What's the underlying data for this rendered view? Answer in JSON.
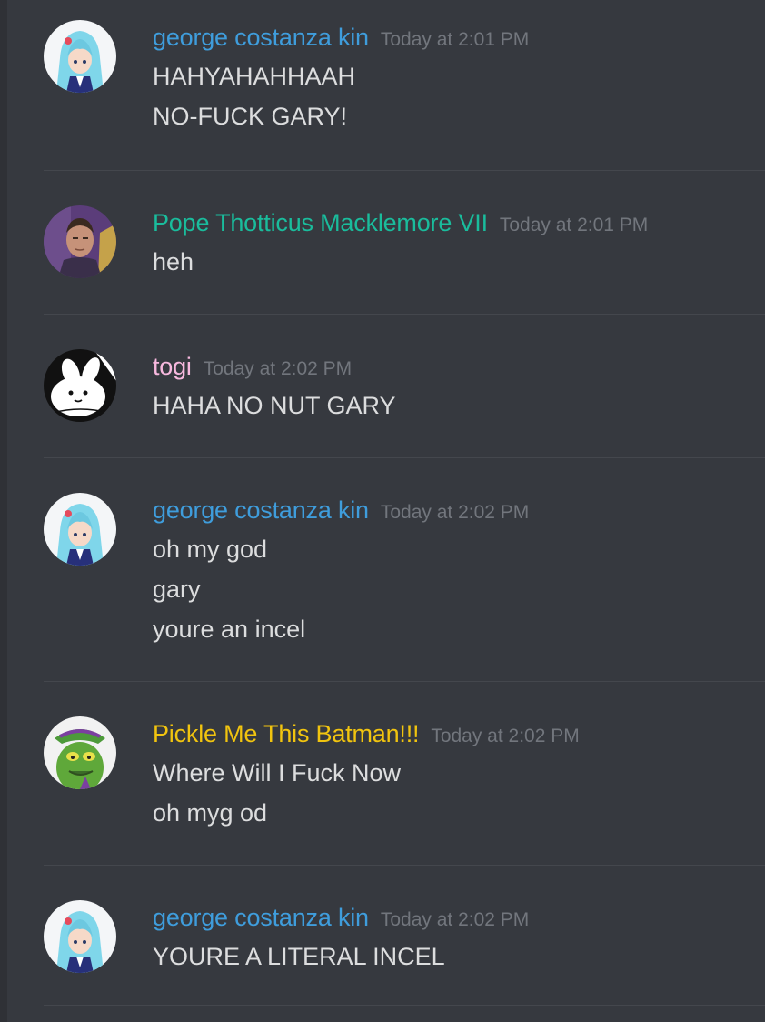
{
  "theme": {
    "background": "#36393f",
    "sidebar_strip": "#2f3136",
    "message_text": "#dcddde",
    "timestamp_color": "#72767d",
    "divider": "#44474d"
  },
  "messages": [
    {
      "author": "george costanza kin",
      "author_color": "#3f9ddc",
      "avatar": "anime-girl-avatar",
      "timestamp": "Today at 2:01 PM",
      "lines": [
        "HAHYAHAHHAAH",
        "NO-FUCK GARY!"
      ]
    },
    {
      "author": "Pope Thotticus Macklemore VII",
      "author_color": "#1abc9c",
      "avatar": "man-portrait-avatar",
      "timestamp": "Today at 2:01 PM",
      "lines": [
        "heh"
      ]
    },
    {
      "author": "togi",
      "author_color": "#f7b8de",
      "avatar": "white-cat-avatar",
      "timestamp": "Today at 2:02 PM",
      "lines": [
        "HAHA NO NUT GARY"
      ]
    },
    {
      "author": "george costanza kin",
      "author_color": "#3f9ddc",
      "avatar": "anime-girl-avatar",
      "timestamp": "Today at 2:02 PM",
      "lines": [
        "oh my god",
        "gary",
        "youre an incel"
      ]
    },
    {
      "author": "Pickle Me This Batman!!!",
      "author_color": "#f1c40f",
      "avatar": "pickle-character-avatar",
      "timestamp": "Today at 2:02 PM",
      "lines": [
        "Where Will I Fuck Now",
        "oh myg od"
      ]
    },
    {
      "author": "george costanza kin",
      "author_color": "#3f9ddc",
      "avatar": "anime-girl-avatar",
      "timestamp": "Today at 2:02 PM",
      "lines": [
        "YOURE A LITERAL INCEL"
      ]
    }
  ]
}
